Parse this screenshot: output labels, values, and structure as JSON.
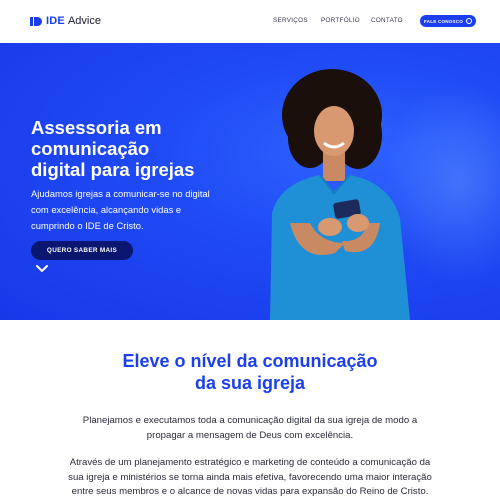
{
  "header": {
    "logo_brand": "IDE",
    "logo_suffix": "Advice",
    "nav": [
      "SERVIÇOS",
      "PORTFÓLIO",
      "CONTATO"
    ],
    "cta_label": "FALE CONOSCO",
    "cta_icon": "whatsapp-icon"
  },
  "hero": {
    "title_lines": [
      "Assessoria em",
      "comunicação",
      "digital para igrejas"
    ],
    "subtitle_lines": [
      "Ajudamos igrejas a comunicar-se no digital",
      "com excelência, alcançando vidas e",
      "cumprindo o IDE de Cristo."
    ],
    "cta_label": "QUERO SABER MAIS",
    "scroll_icon": "chevron-down-icon"
  },
  "section2": {
    "title_lines": [
      "Eleve o nível da comunicação",
      "da sua igreja"
    ],
    "paragraph1_lines": [
      "Planejamos e executamos toda a comunicação digital da sua igreja de modo a",
      "propagar a mensagem de Deus com excelência."
    ],
    "paragraph2_lines": [
      "Através de um planejamento estratégico e marketing de conteúdo a comunicação da",
      "sua igreja e ministérios se torna ainda mais efetiva, favorecendo uma maior interação",
      "entre seus membros e o alcance de novas vidas para expansão do Reino de Cristo."
    ]
  },
  "colors": {
    "brand_blue": "#1b3ff0",
    "dark_navy": "#0a1670",
    "text": "#2a2a3a"
  }
}
